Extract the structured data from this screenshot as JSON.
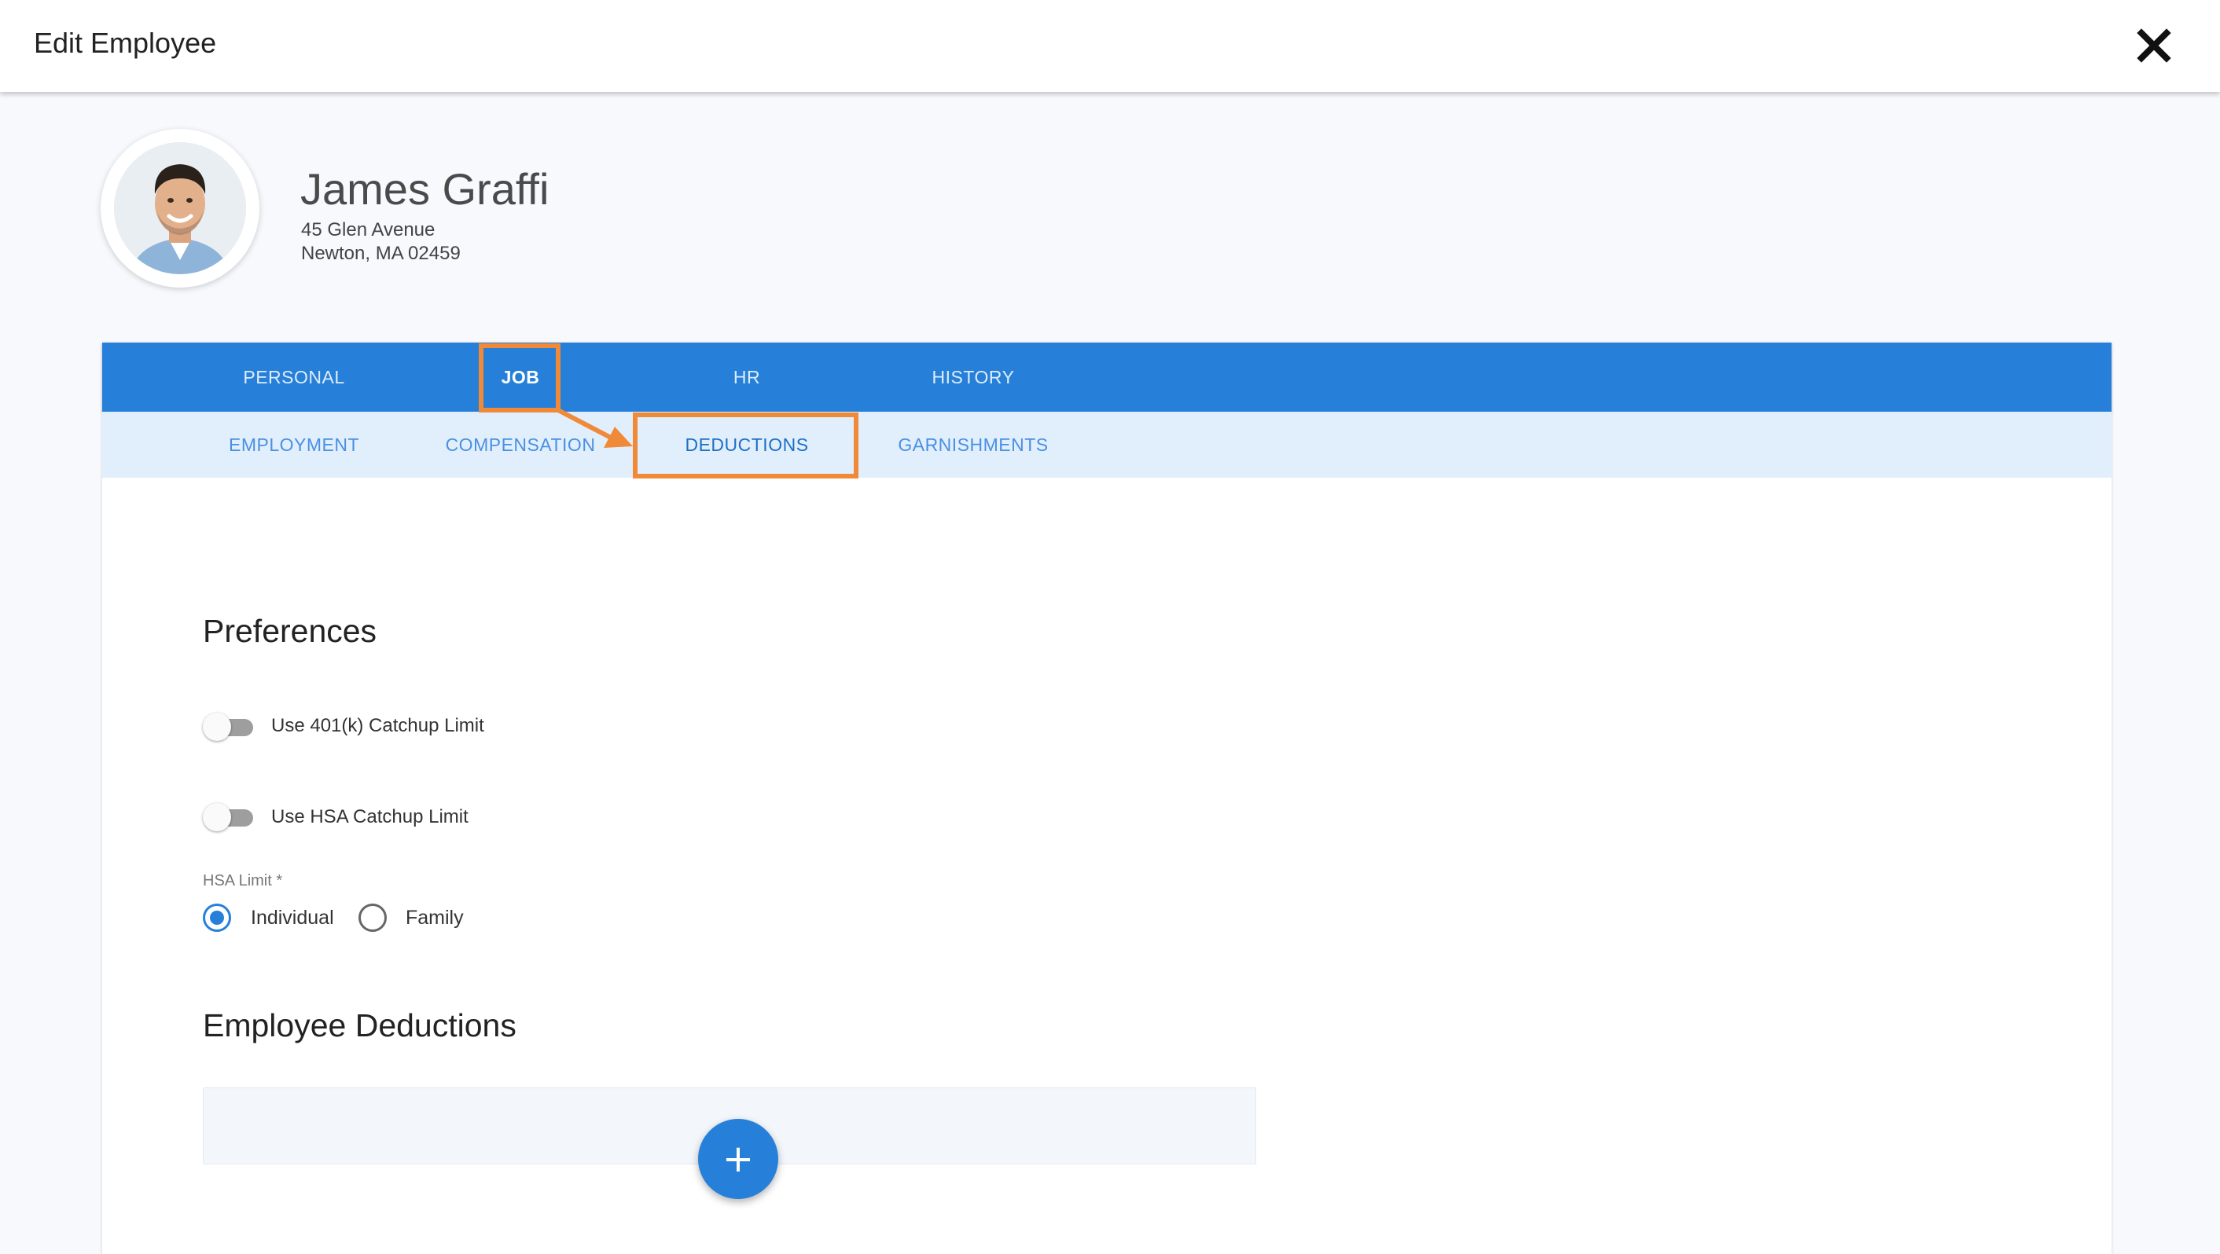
{
  "header": {
    "title": "Edit Employee",
    "close_icon": "close-icon"
  },
  "employee": {
    "name": "James Graffi",
    "address_line1": "45 Glen Avenue",
    "address_line2": "Newton, MA 02459",
    "avatar_icon": "employee-photo"
  },
  "tabs": {
    "primary": [
      {
        "label": "PERSONAL",
        "active": false
      },
      {
        "label": "JOB",
        "active": true
      },
      {
        "label": "HR",
        "active": false
      },
      {
        "label": "HISTORY",
        "active": false
      }
    ],
    "secondary": [
      {
        "label": "EMPLOYMENT",
        "active": false
      },
      {
        "label": "COMPENSATION",
        "active": false
      },
      {
        "label": "DEDUCTIONS",
        "active": true
      },
      {
        "label": "GARNISHMENTS",
        "active": false
      }
    ]
  },
  "preferences": {
    "heading": "Preferences",
    "toggles": [
      {
        "label": "Use 401(k) Catchup Limit",
        "on": false
      },
      {
        "label": "Use HSA Catchup Limit",
        "on": false
      }
    ],
    "hsa_limit": {
      "label": "HSA Limit *",
      "options": [
        {
          "label": "Individual",
          "selected": true
        },
        {
          "label": "Family",
          "selected": false
        }
      ]
    }
  },
  "deductions": {
    "heading": "Employee Deductions",
    "add_button": "+"
  },
  "colors": {
    "primary": "#2680d9",
    "secondary_tab_bg": "#e1effc",
    "annotation": "#f08a38"
  }
}
